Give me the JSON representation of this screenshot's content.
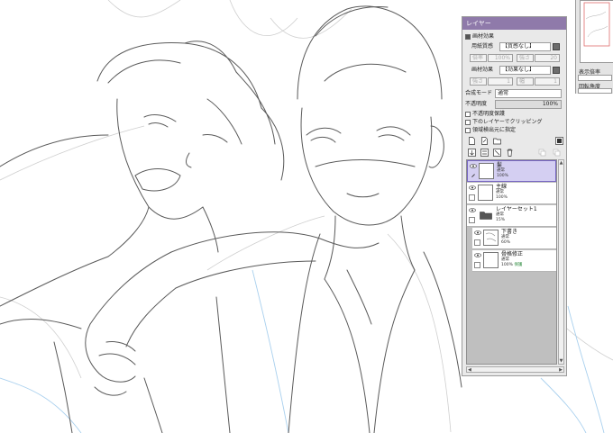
{
  "panel": {
    "title": "レイヤー",
    "paper_effect_header": "画材効果",
    "paper_texture_label": "用紙質感",
    "paper_texture_value": "【質感なし】",
    "texture_scale_label": "倍率",
    "texture_scale_value": "100%",
    "texture_strength_label": "強さ",
    "texture_strength_value": "20",
    "paper_effect_label": "画材効果",
    "paper_effect_value": "【効果なし】",
    "effect_strength_label": "強さ",
    "effect_strength_value": "1",
    "effect_width_label": "幅",
    "effect_width_value": "1",
    "blend_mode_label": "合成モード",
    "blend_mode_value": "通常",
    "opacity_label": "不透明度",
    "opacity_value": "100%",
    "preserve_opacity_label": "不透明度保護",
    "clipping_label": "下のレイヤーでクリッピング",
    "selection_source_label": "領域検出元に指定"
  },
  "layers": [
    {
      "name": "髪",
      "mode": "通常",
      "opacity": "100%",
      "flag": "",
      "selected": true
    },
    {
      "name": "主線",
      "mode": "通常",
      "opacity": "100%",
      "flag": "",
      "selected": false
    },
    {
      "name": "レイヤーセット1",
      "mode": "通常",
      "opacity": "15%",
      "flag": "",
      "selected": false
    },
    {
      "name": "下書き",
      "mode": "通常",
      "opacity": "60%",
      "flag": "",
      "selected": false
    },
    {
      "name": "骨格修正",
      "mode": "通常",
      "opacity": "100%",
      "flag": "保護",
      "selected": false
    }
  ],
  "navigator": {
    "zoom_label": "表示倍率",
    "angle_label": "回転角度"
  },
  "colors": {
    "title_bar": "#8f7aaa",
    "selected_layer": "#d4cff2",
    "line_art": "#555555",
    "sketch_blue": "#9ec7e8"
  }
}
